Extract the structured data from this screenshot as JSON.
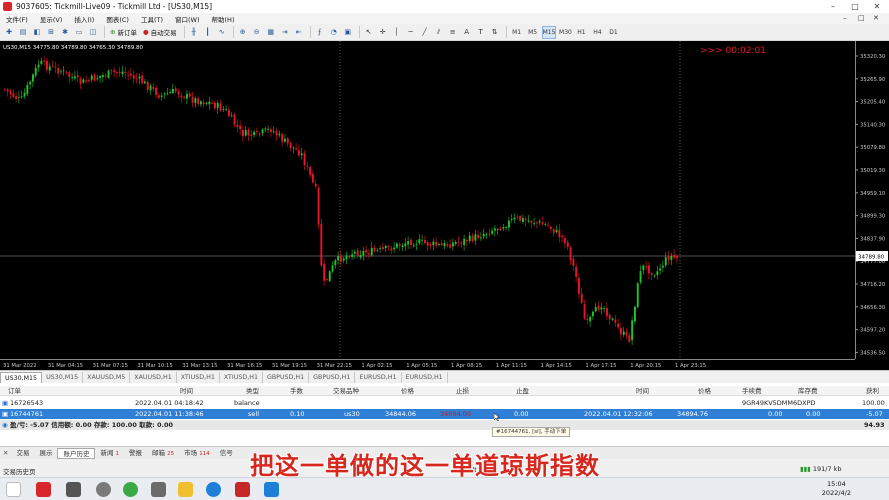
{
  "window": {
    "title": "9037605: Tickmill-Live09 - Tickmill Ltd - [US30,M15]",
    "minimize": "–",
    "maximize": "□",
    "close": "✕"
  },
  "menu": [
    "文件(F)",
    "显示(V)",
    "插入(I)",
    "图表(C)",
    "工具(T)",
    "窗口(W)",
    "帮助(H)"
  ],
  "toolbar": {
    "new_order": "新订单",
    "auto_trade": "自动交易",
    "timeframes": [
      "M1",
      "M5",
      "M15",
      "M30",
      "H1",
      "H4",
      "D1"
    ],
    "active_timeframe": "M15"
  },
  "chart": {
    "header": "US30,M15  34775.80 34789.80 34765.30 34789.80",
    "countdown": ">>> 00:02:01",
    "current_price": "34789.80",
    "price_labels": [
      "35320.30",
      "35265.90",
      "35205.40",
      "35140.30",
      "35079.80",
      "35019.30",
      "34959.10",
      "34899.30",
      "34837.90",
      "34777.80",
      "34716.20",
      "34656.30",
      "34597.20",
      "34536.50"
    ],
    "time_labels": [
      "31 Mar 2022",
      "31 Mar 04:15",
      "31 Mar 07:15",
      "31 Mar 10:15",
      "31 Mar 13:15",
      "31 Mar 16:15",
      "31 Mar 19:15",
      "31 Mar 22:15",
      "1 Apr 02:15",
      "1 Apr 05:15",
      "1 Apr 08:15",
      "1 Apr 11:15",
      "1 Apr 14:15",
      "1 Apr 17:15",
      "1 Apr 20:15",
      "1 Apr 23:15"
    ],
    "colors": {
      "bull": "#21c42a",
      "bear": "#e8152a",
      "background": "#000000",
      "countdown": "#e8152a"
    }
  },
  "symbol_tabs": [
    "US30,M15",
    "US30,M15",
    "XAUUSD,M5",
    "XAUUSD,H1",
    "XTIUSD,H1",
    "XTIUSD,H1",
    "GBPUSD,H1",
    "GBPUSD,H1",
    "EURUSD,H1",
    "EURUSD,H1"
  ],
  "terminal": {
    "headers": [
      "订单",
      "时间",
      "类型",
      "手数",
      "交易品种",
      "价格",
      "止损",
      "止盈",
      "时间",
      "价格",
      "手续费",
      "库存费",
      "获利"
    ],
    "row1": {
      "order": "16726543",
      "time": "2022.04.01 04:18:42",
      "type": "balance",
      "commission": "9GR49KV5DMM6DXPD",
      "profit": "100.00"
    },
    "row2": {
      "order": "16744761",
      "time": "2022.04.01 11:38:46",
      "type": "sell",
      "lots": "0.10",
      "symbol": "us30",
      "price": "34844.06",
      "sl": "34894.00",
      "tp": "0.00",
      "close_time": "2022.04.01 12:32:06",
      "close_price": "34894.76",
      "fee": "0.00",
      "swap": "0.00",
      "profit": "-5.07"
    },
    "summary": {
      "text": "盈/亏: -5.07  信用额: 0.00  存款: 100.00  取款: 0.00",
      "total": "94.93"
    },
    "tooltip": "#16744761, [sl], 手动下单"
  },
  "terminal_tabs": [
    {
      "label": "交易",
      "badge": ""
    },
    {
      "label": "展示",
      "badge": ""
    },
    {
      "label": "账户历史",
      "badge": ""
    },
    {
      "label": "新闻",
      "badge": "1"
    },
    {
      "label": "警报",
      "badge": ""
    },
    {
      "label": "邮箱",
      "badge": "25"
    },
    {
      "label": "市场",
      "badge": "114"
    },
    {
      "label": "信号",
      "badge": ""
    }
  ],
  "status": {
    "left": "交易历史页",
    "default": "Default",
    "network": "191/7 kb"
  },
  "subtitle": "把这一单做的这一单道琼斯指数",
  "clock": {
    "time": "15:04",
    "date": "2022/4/2"
  }
}
